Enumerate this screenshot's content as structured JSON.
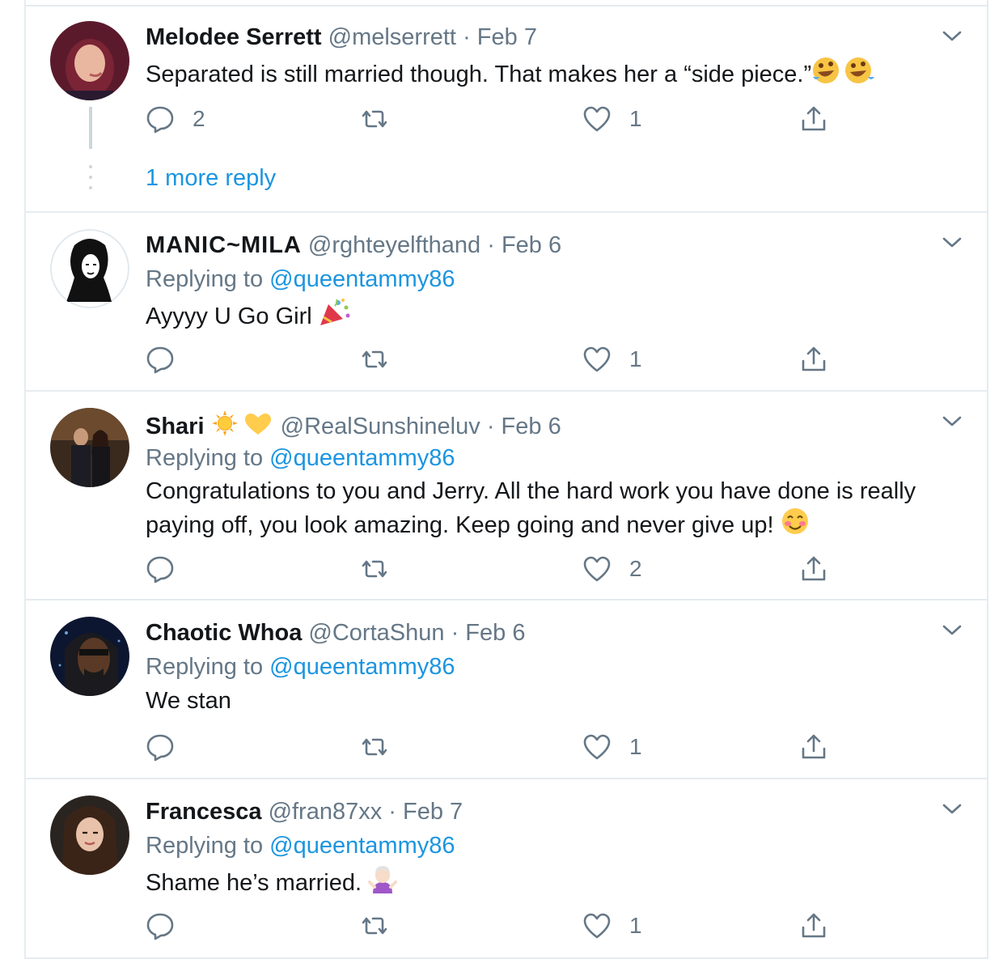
{
  "colors": {
    "link": "#1b95e0",
    "meta": "#657786",
    "border": "#e6ecf0"
  },
  "tweets": [
    {
      "name": "Melodee Serrett",
      "handle": "@melserrett",
      "sep": "·",
      "date": "Feb 7",
      "replying_label": "",
      "replying_to": "",
      "text": "Separated is still married though. That makes her a “side piece.”",
      "emoji_icon": "rolling-on-floor-laughing-icon",
      "replies": "2",
      "retweets": "",
      "likes": "1",
      "more_replies": "1 more reply"
    },
    {
      "name": "MANIC~MILA",
      "handle": "@rghteyelfthand",
      "sep": "·",
      "date": "Feb 6",
      "replying_label": "Replying to",
      "replying_to": "@queentammy86",
      "text": "Ayyyy U Go Girl",
      "emoji_icon": "party-popper-icon",
      "replies": "",
      "retweets": "",
      "likes": "1"
    },
    {
      "name": "Shari",
      "handle": "@RealSunshineluv",
      "sep": "·",
      "date": "Feb 6",
      "replying_label": "Replying to",
      "replying_to": "@queentammy86",
      "text": "Congratulations to you and Jerry. All the hard work you have done is really paying off, you look amazing. Keep going and never give up!",
      "emoji_icon": "smiling-blush-icon",
      "name_emoji": "sun-and-yellow-heart-icons",
      "replies": "",
      "retweets": "",
      "likes": "2"
    },
    {
      "name": "Chaotic Whoa",
      "handle": "@CortaShun",
      "sep": "·",
      "date": "Feb 6",
      "replying_label": "Replying to",
      "replying_to": "@queentammy86",
      "text": "We stan",
      "replies": "",
      "retweets": "",
      "likes": "1"
    },
    {
      "name": "Francesca",
      "handle": "@fran87xx",
      "sep": "·",
      "date": "Feb 7",
      "replying_label": "Replying to",
      "replying_to": "@queentammy86",
      "text": "Shame he’s married.",
      "emoji_icon": "person-shrugging-icon",
      "replies": "",
      "retweets": "",
      "likes": "1"
    }
  ]
}
